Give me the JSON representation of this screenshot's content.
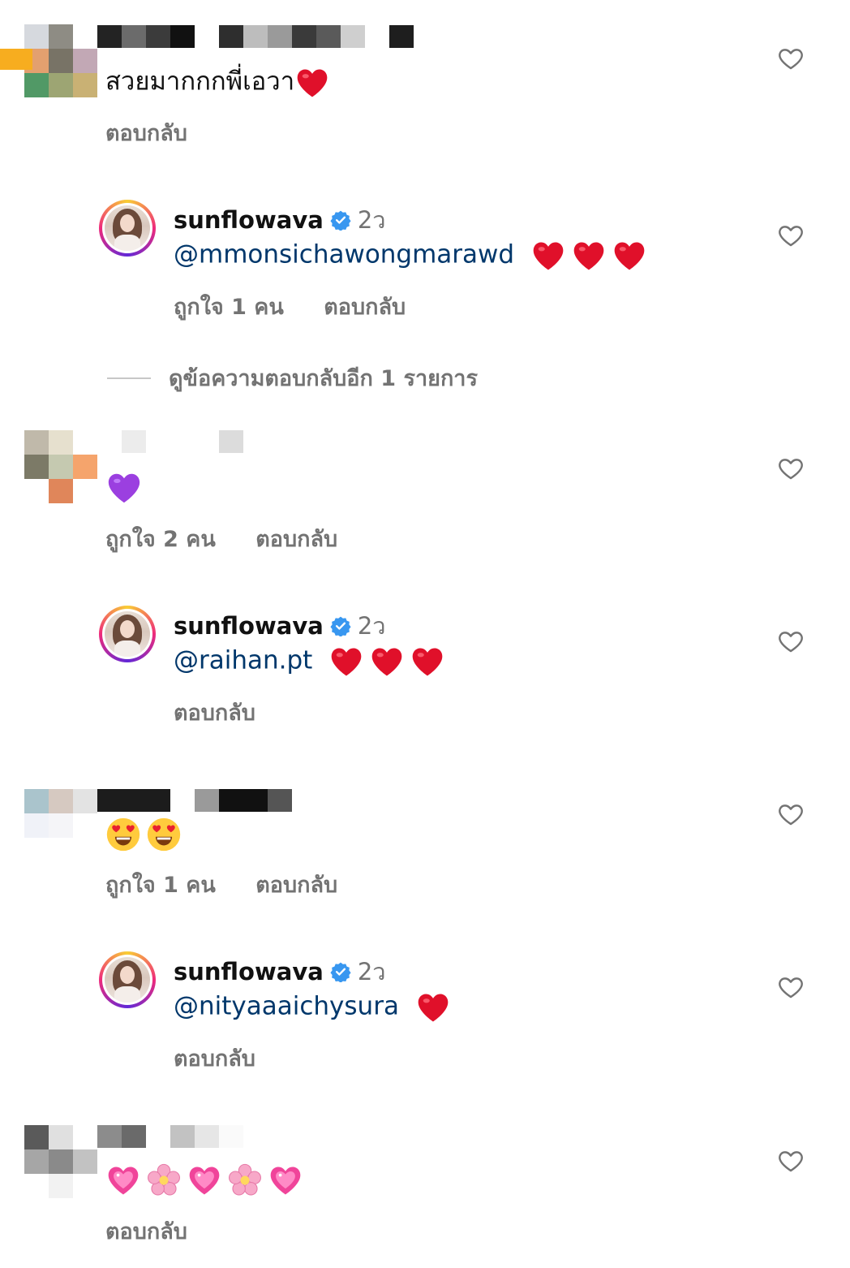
{
  "comments": [
    {
      "text": "สวยมากกกพี่เอวา",
      "reply_label": "ตอบกลับ",
      "reply": {
        "username": "sunflowava",
        "time": "2ว",
        "mention": "@mmonsichawongmarawd",
        "likes_text": "ถูกใจ 1 คน",
        "reply_label": "ตอบกลับ"
      },
      "view_more": "ดูข้อความตอบกลับอีก 1 รายการ"
    },
    {
      "likes_text": "ถูกใจ 2 คน",
      "reply_label": "ตอบกลับ",
      "reply": {
        "username": "sunflowava",
        "time": "2ว",
        "mention": "@raihan.pt",
        "reply_label": "ตอบกลับ"
      }
    },
    {
      "likes_text": "ถูกใจ 1 คน",
      "reply_label": "ตอบกลับ",
      "reply": {
        "username": "sunflowava",
        "time": "2ว",
        "mention": "@nityaaaichysura",
        "reply_label": "ตอบกลับ"
      }
    },
    {
      "reply_label": "ตอบกลับ"
    }
  ],
  "icons": {
    "like": "heart-outline-icon",
    "verified": "verified-badge-icon",
    "red_heart": "red-heart-emoji",
    "purple_heart": "purple-heart-emoji",
    "heart_eyes": "heart-eyes-emoji",
    "sparkling_heart": "sparkling-heart-emoji",
    "blossom": "cherry-blossom-emoji"
  },
  "colors": {
    "mention": "#00376b",
    "meta": "#737373",
    "verified": "#3897f0"
  }
}
